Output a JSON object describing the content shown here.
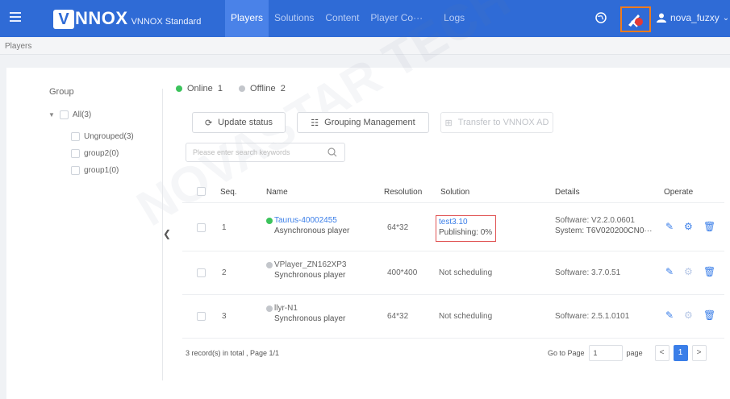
{
  "header": {
    "logo_mark": "V",
    "logo_word": "NNOX",
    "logo_sub": "VNNOX Standard",
    "nav": [
      "Players",
      "Solutions",
      "Content",
      "Player Co···",
      "Logs"
    ],
    "active_nav": "Players",
    "user_name": "nova_fuzxy",
    "accent_color": "#2f6bd6",
    "highlight_color": "#f07b1d"
  },
  "breadcrumb": "Players",
  "sidebar": {
    "title": "Group",
    "root": "All(3)",
    "children": [
      "Ungrouped(3)",
      "group2(0)",
      "group1(0)"
    ]
  },
  "status": {
    "online_label": "Online",
    "online_count": "1",
    "offline_label": "Offline",
    "offline_count": "2"
  },
  "toolbar": {
    "update_status": "Update status",
    "grouping_management": "Grouping Management",
    "transfer": "Transfer to VNNOX AD"
  },
  "search": {
    "placeholder": "Please enter search keywords"
  },
  "table": {
    "headers": {
      "seq": "Seq.",
      "name": "Name",
      "resolution": "Resolution",
      "solution": "Solution",
      "details": "Details",
      "operate": "Operate"
    },
    "rows": [
      {
        "seq": "1",
        "name": "Taurus-40002455",
        "type": "Asynchronous player",
        "status": "online",
        "resolution": "64*32",
        "solution": "test3.10",
        "solution_sub": "Publishing: 0%",
        "details_1": "Software: V2.2.0.0601",
        "details_2": "System: T6V020200CN0···"
      },
      {
        "seq": "2",
        "name": "VPlayer_ZN162XP3",
        "type": "Synchronous player",
        "status": "offline",
        "resolution": "400*400",
        "solution": "Not scheduling",
        "details_1": "Software: 3.7.0.51"
      },
      {
        "seq": "3",
        "name": "llyr-N1",
        "type": "Synchronous player",
        "status": "offline",
        "resolution": "64*32",
        "solution": "Not scheduling",
        "details_1": "Software: 2.5.1.0101"
      }
    ]
  },
  "footer": {
    "summary": "3 record(s) in total , Page 1/1",
    "goto_label": "Go to Page",
    "goto_value": "1",
    "page_label": "page",
    "prev": "<",
    "current": "1",
    "next": ">"
  },
  "watermark": "NOVASTAR TECH CO"
}
